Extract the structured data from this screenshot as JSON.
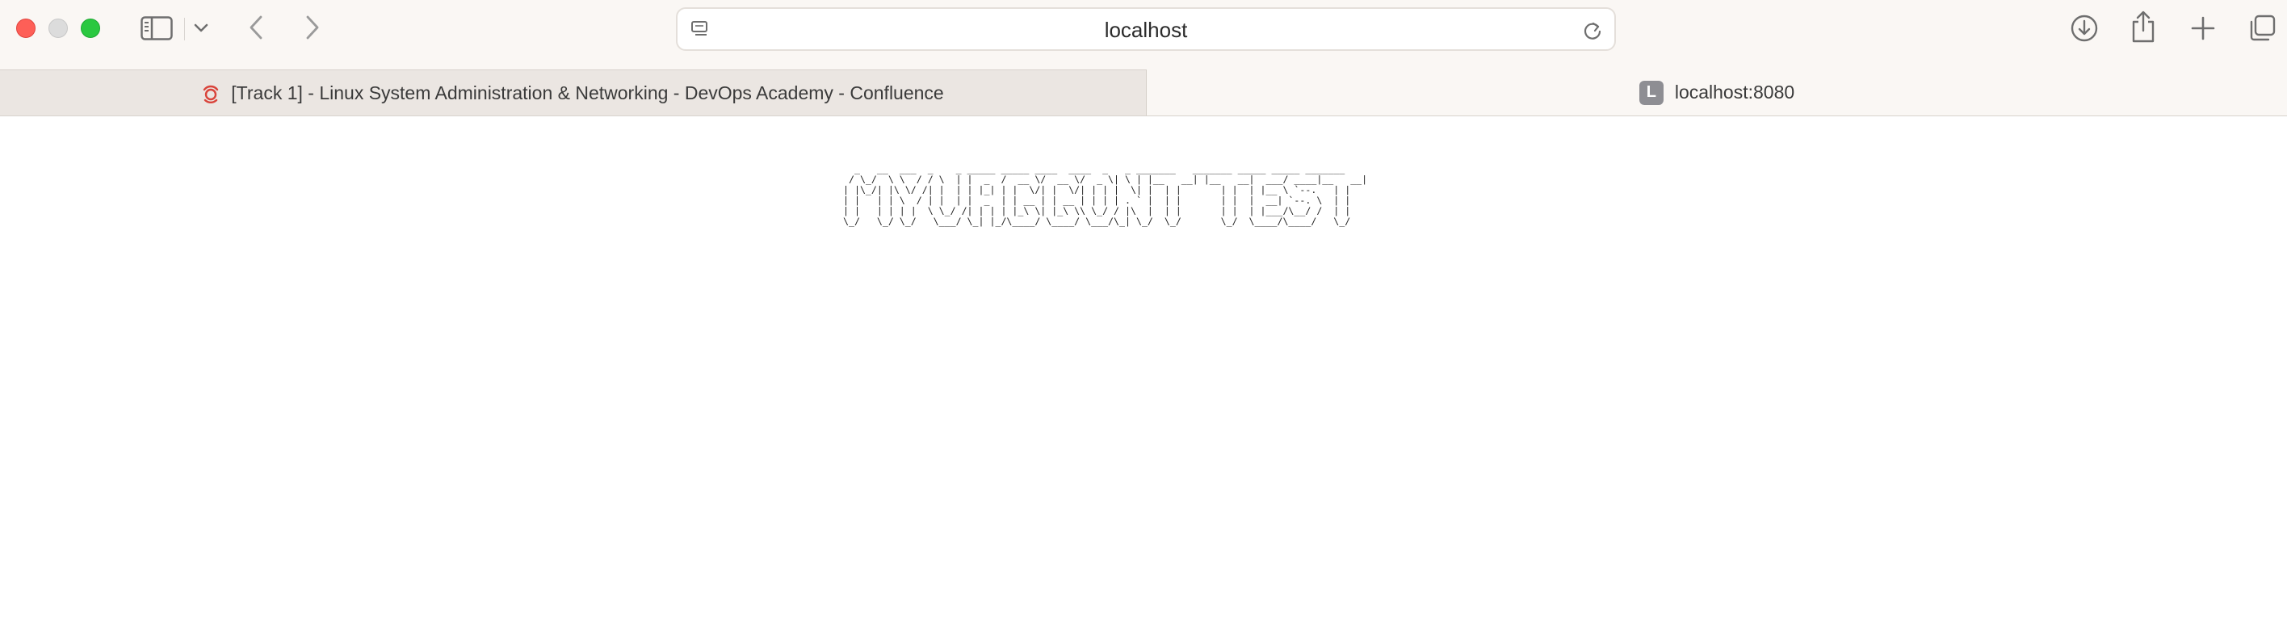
{
  "browser": {
    "address_bar": {
      "url": "localhost"
    },
    "tabs": [
      {
        "label": "[Track 1] - Linux System Administration & Networking - DevOps Academy - Confluence",
        "favicon": "confluence-icon",
        "active": false
      },
      {
        "label": "localhost:8080",
        "favicon_letter": "L",
        "active": true
      }
    ]
  },
  "content": {
    "ascii_art": "  _   __  ___  _    _ _____ _____ ____  ____  _   _ _______   _______ _____ _____ _______\n / \\_/  \\ \\  / / \\  | |  _  /  __ \\/  __ \\/  _ \\| \\ | |__   __| |__   __|  ___/ ____|__   __|\n| |\\_/| |\\ \\/ /| |  | | |_| | |  \\/| |  \\/| | | |  \\| |  | |       | |  | |__ \\ `--.   | |\n| |   | | \\  / | |  | |  _  | | __ | | __ | | | | . ` |  | |       | |  |  __| `--. \\  | |\n| |   | | | |  \\ \\_/ /| | | | |_\\ \\| |_\\ \\\\ \\_/ / |\\  |  | |       | |  | |___/\\__/ /  | |\n\\_/   \\_/ \\_/   \\___/ \\_| |_/\\____/ \\____/ \\___/\\_| \\_/  \\_/       \\_/  \\____/\\____/   \\_/"
  },
  "colors": {
    "toolbar_bg": "#faf7f4",
    "inactive_tab_bg": "#ebe6e2",
    "close": "#fe5f57",
    "minimize": "#dcdcdc",
    "maximize": "#2ac840",
    "letter_favicon_bg": "#8e8e93"
  }
}
